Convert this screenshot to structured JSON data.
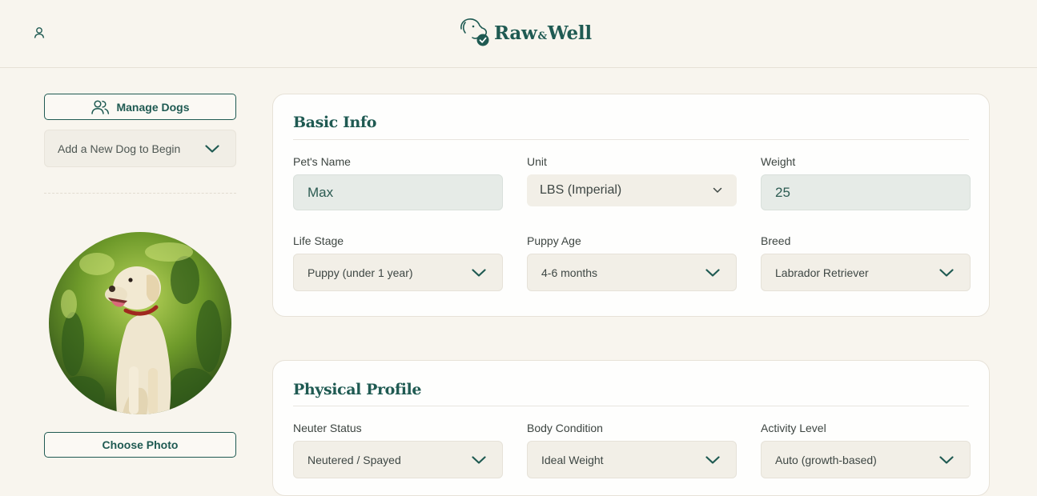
{
  "header": {
    "brand_part1": "Raw",
    "brand_amp": "&",
    "brand_part2": "Well",
    "user_icon": "user-icon",
    "logo_icon": "dog-head-check-icon"
  },
  "sidebar": {
    "manage_dogs_label": "Manage Dogs",
    "dog_select_value": "Add a New Dog to Begin",
    "choose_photo_label": "Choose Photo"
  },
  "basic_info": {
    "title": "Basic Info",
    "pet_name_label": "Pet's Name",
    "pet_name_value": "Max",
    "unit_label": "Unit",
    "unit_value": "LBS (Imperial)",
    "weight_label": "Weight",
    "weight_value": "25",
    "life_stage_label": "Life Stage",
    "life_stage_value": "Puppy (under 1 year)",
    "puppy_age_label": "Puppy Age",
    "puppy_age_value": "4-6 months",
    "breed_label": "Breed",
    "breed_value": "Labrador Retriever"
  },
  "physical_profile": {
    "title": "Physical Profile",
    "neuter_label": "Neuter Status",
    "neuter_value": "Neutered / Spayed",
    "body_label": "Body Condition",
    "body_value": "Ideal Weight",
    "activity_label": "Activity Level",
    "activity_value": "Auto (growth-based)"
  },
  "colors": {
    "brand_green": "#1f5a52",
    "background": "#f8f5ee",
    "input_fill": "#e6ebe7",
    "select_fill": "#f2efe7"
  }
}
